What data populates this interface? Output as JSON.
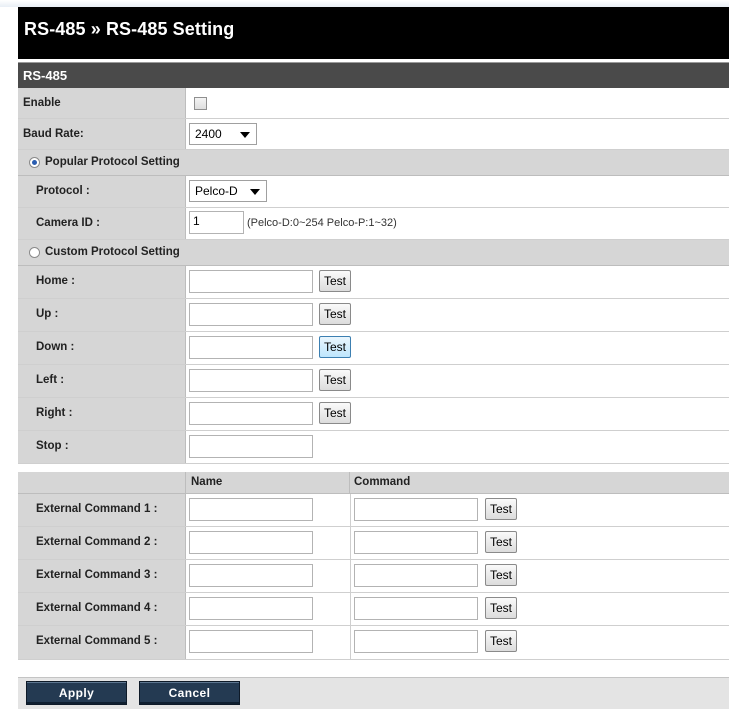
{
  "page": {
    "breadcrumb": "RS-485 » RS-485 Setting",
    "section_title": "RS-485"
  },
  "general": {
    "enable_label": "Enable",
    "enable_checked": false,
    "baud_label": "Baud Rate:",
    "baud_value": "2400"
  },
  "popular": {
    "group_label": "Popular Protocol Setting",
    "selected": true,
    "protocol_label": "Protocol :",
    "protocol_value": "Pelco-D",
    "camera_id_label": "Camera ID :",
    "camera_id_value": "1",
    "camera_id_hint": "(Pelco-D:0~254 Pelco-P:1~32)"
  },
  "custom": {
    "group_label": "Custom Protocol Setting",
    "selected": false,
    "test_label": "Test",
    "rows": [
      {
        "label": "Home :",
        "value": ""
      },
      {
        "label": "Up :",
        "value": ""
      },
      {
        "label": "Down :",
        "value": ""
      },
      {
        "label": "Left :",
        "value": ""
      },
      {
        "label": "Right :",
        "value": ""
      },
      {
        "label": "Stop :",
        "value": ""
      }
    ]
  },
  "external": {
    "name_header": "Name",
    "command_header": "Command",
    "test_label": "Test",
    "rows": [
      {
        "label": "External Command 1 :",
        "name": "",
        "command": ""
      },
      {
        "label": "External Command 2 :",
        "name": "",
        "command": ""
      },
      {
        "label": "External Command 3 :",
        "name": "",
        "command": ""
      },
      {
        "label": "External Command 4 :",
        "name": "",
        "command": ""
      },
      {
        "label": "External Command 5 :",
        "name": "",
        "command": ""
      }
    ]
  },
  "actions": {
    "apply_label": "Apply",
    "cancel_label": "Cancel"
  },
  "colors": {
    "title_bg": "#000000",
    "section_bg": "#4a4a4a",
    "label_bg": "#d6d6d6",
    "footer_button_bg": "#243a52"
  }
}
